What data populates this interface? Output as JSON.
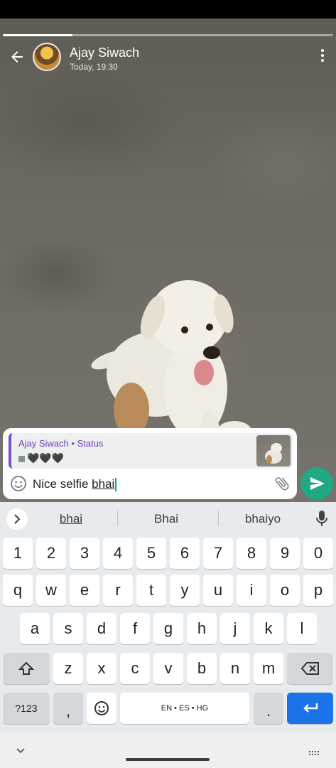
{
  "status": {
    "contact_name": "Ajay Siwach",
    "timestamp": "Today, 19:30",
    "progress_fraction": 0.21
  },
  "icons": {
    "back": "arrow-left-icon",
    "menu": "more-vertical-icon",
    "emoji": "smiley-icon",
    "attach": "paperclip-icon",
    "send": "send-icon",
    "mic": "microphone-icon"
  },
  "reply": {
    "title": "Ajay Siwach • Status",
    "hearts": "🖤🖤🖤"
  },
  "composer": {
    "text_prefix": "Nice selfie ",
    "text_word": "bhai"
  },
  "keyboard": {
    "suggestions": [
      "bhai",
      "Bhai",
      "bhaiyo"
    ],
    "numbers": [
      "1",
      "2",
      "3",
      "4",
      "5",
      "6",
      "7",
      "8",
      "9",
      "0"
    ],
    "row1": [
      "q",
      "w",
      "e",
      "r",
      "t",
      "y",
      "u",
      "i",
      "o",
      "p"
    ],
    "row2": [
      "a",
      "s",
      "d",
      "f",
      "g",
      "h",
      "j",
      "k",
      "l"
    ],
    "row3": [
      "z",
      "x",
      "c",
      "v",
      "b",
      "n",
      "m"
    ],
    "symbols_label": "?123",
    "comma": ",",
    "space_label": "EN • ES • HG",
    "period": "."
  },
  "colors": {
    "accent_green": "#1fa883",
    "reply_purple": "#6b3fb4",
    "enter_blue": "#1a73e8"
  }
}
